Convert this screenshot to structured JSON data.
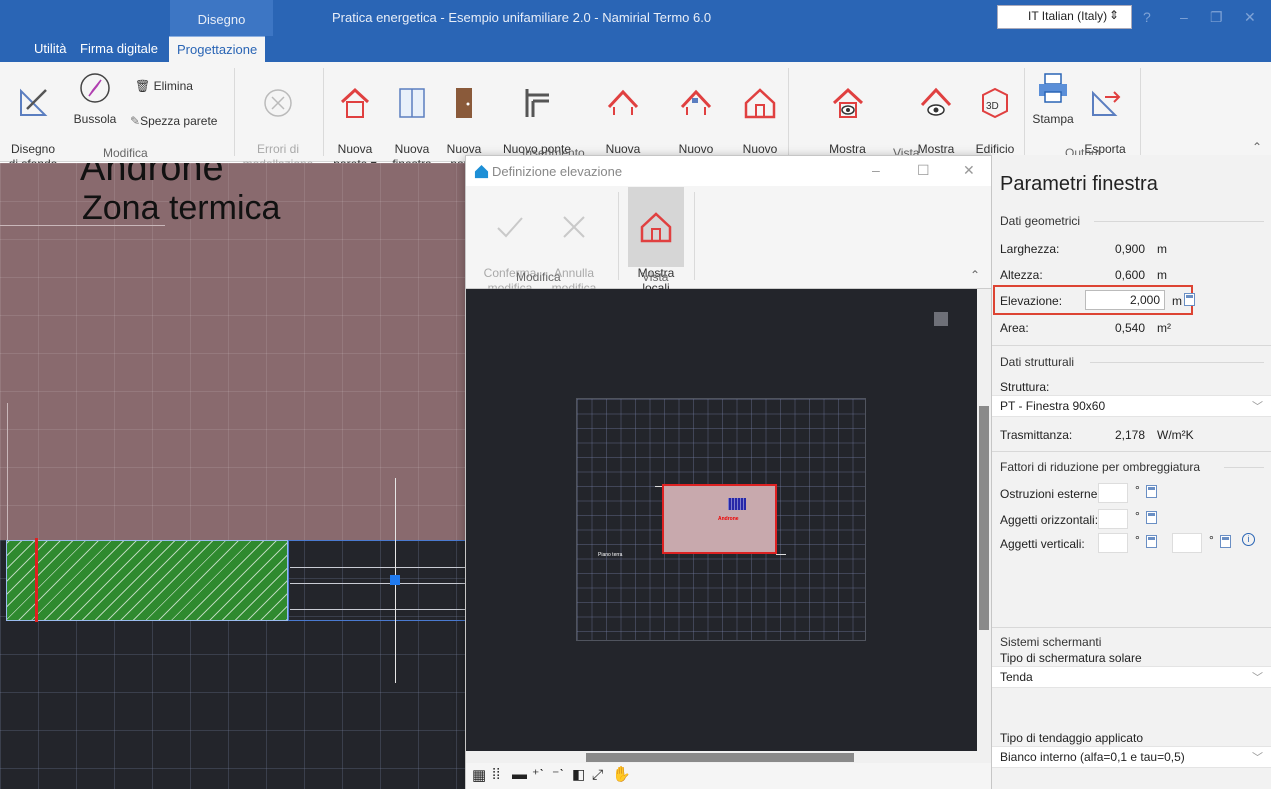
{
  "titlebar": {
    "context_tab": "Disegno",
    "app_title": "Pratica energetica - Esempio unifamiliare 2.0 - Namirial Termo 6.0",
    "language": "IT Italian (Italy)"
  },
  "tabs": [
    "Utilità",
    "Firma digitale",
    "Progettazione"
  ],
  "ribbon": {
    "disegno_di_sfondo": "Disegno\ndi sfondo",
    "bussola": "Bussola",
    "elimina": "Elimina",
    "spezza_parete": "Spezza parete",
    "errori_di_modellazione": "Errori di\nmodellazione",
    "nuova_parete": "Nuova\nparete ▾",
    "nuova_finestra": "Nuova\nfinestra",
    "nuova_porta": "Nuova\nporta",
    "nuovo_ponte_termico": "Nuovo ponte\ntermico",
    "nuova_copertura": "Nuova\ncopertura ▾",
    "nuovo_lucernario": "Nuovo\nlucernario",
    "nuovo_locale": "Nuovo\nlocale",
    "mostra_ancoraggio_pareti": "Mostra\nancoraggio pareti",
    "mostra_coperture": "Mostra\ncoperture",
    "edificio_3d": "Edificio\n3D",
    "stampa": "Stampa",
    "esporta_in_dxf": "Esporta\nin DXF",
    "group_modifica": "Modifica",
    "group_inserimento": "Inserimento",
    "group_vista": "Vista",
    "group_output": "Output"
  },
  "canvas": {
    "zone_name": "Androne",
    "zone_sub": "Zona termica"
  },
  "dialog": {
    "title": "Definizione elevazione",
    "conferma": "Conferma\nmodifica",
    "annulla": "Annulla\nmodifica",
    "mostra_locali": "Mostra\nlocali",
    "group_modifica": "Modifica",
    "group_vista": "Vista",
    "room_label": "Androne",
    "floor_label": "Piano terra"
  },
  "panel": {
    "title": "Parametri finestra",
    "sec_geom": "Dati geometrici",
    "larghezza_label": "Larghezza:",
    "larghezza_val": "0,900",
    "altezza_label": "Altezza:",
    "altezza_val": "0,600",
    "elevazione_label": "Elevazione:",
    "elevazione_val": "2,000",
    "area_label": "Area:",
    "area_val": "0,540",
    "unit_m": "m",
    "unit_m2": "m²",
    "sec_strutt": "Dati strutturali",
    "struttura_label": "Struttura:",
    "struttura_val": "PT - Finestra 90x60",
    "trasmittanza_label": "Trasmittanza:",
    "trasmittanza_val": "2,178",
    "trasmittanza_unit": "W/m²K",
    "sec_ombre": "Fattori di riduzione per ombreggiatura",
    "ostruzioni_label": "Ostruzioni esterne:",
    "aggetti_o_label": "Aggetti orizzontali:",
    "aggetti_v_label": "Aggetti verticali:",
    "deg": "°",
    "sec_sistemi": "Sistemi schermanti",
    "tipo_sch_label": "Tipo di schermatura solare",
    "tipo_sch_val": "Tenda",
    "tipo_tend_label": "Tipo di tendaggio applicato",
    "tipo_tend_val": "Bianco interno (alfa=0,1 e tau=0,5)"
  }
}
